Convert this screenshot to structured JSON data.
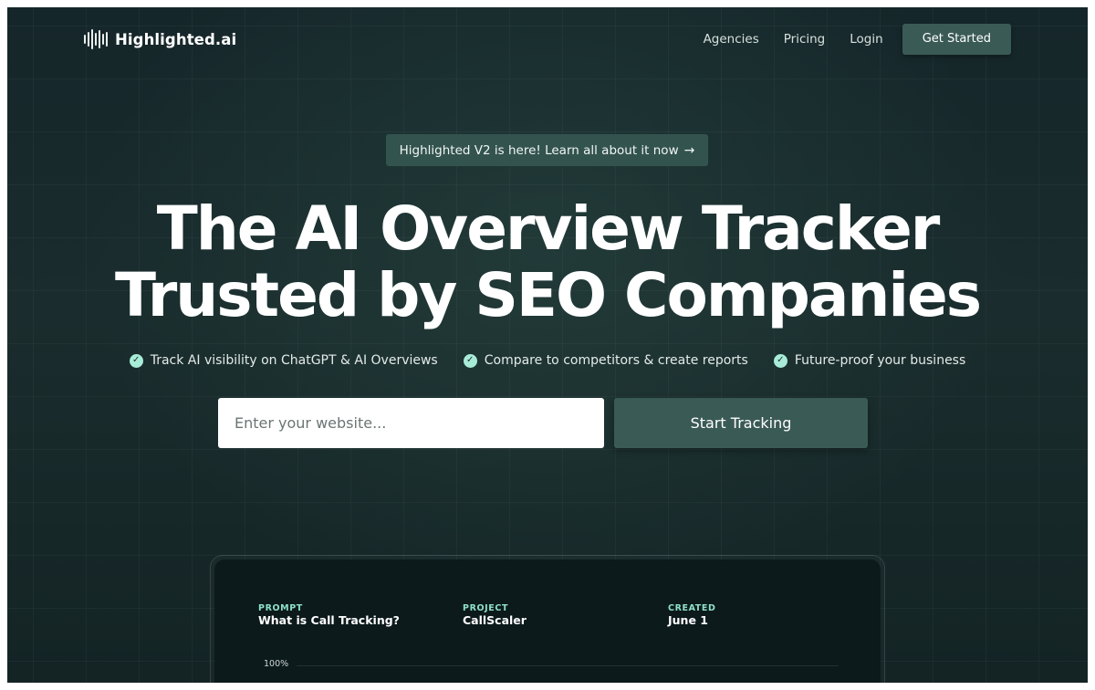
{
  "brand": {
    "name": "Highlighted.ai"
  },
  "nav": {
    "links": [
      "Agencies",
      "Pricing",
      "Login"
    ],
    "cta": "Get Started"
  },
  "banner": {
    "text": "Highlighted V2 is here! Learn all about it now",
    "arrow": "→"
  },
  "hero": {
    "line1": "The AI Overview Tracker",
    "line2": "Trusted by SEO Companies"
  },
  "features": [
    "Track AI visibility on ChatGPT & AI Overviews",
    "Compare to competitors & create reports",
    "Future-proof your business"
  ],
  "form": {
    "placeholder": "Enter your website...",
    "button": "Start Tracking"
  },
  "preview": {
    "prompt_label": "PROMPT",
    "prompt_value": "What is Call Tracking?",
    "project_label": "PROJECT",
    "project_value": "CallScaler",
    "created_label": "CREATED",
    "created_value": "June 1",
    "axis_label": "100%"
  },
  "colors": {
    "background": "#1a2c2d",
    "accent_button": "#3a5a55",
    "check": "#a8ecd8",
    "label_accent": "#8ee0c8"
  },
  "icons": [
    "sound-wave-logo-icon",
    "arrow-right-icon",
    "check-circle-icon"
  ]
}
